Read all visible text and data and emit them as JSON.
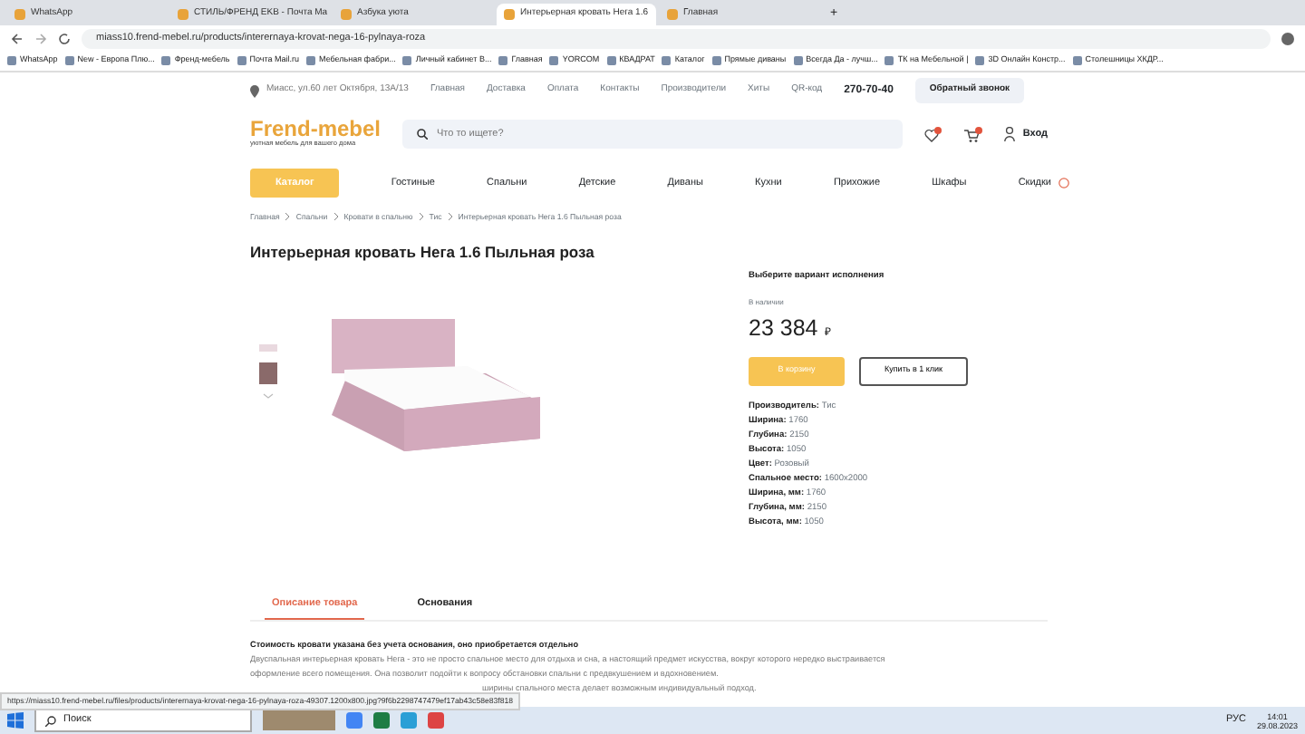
{
  "browser": {
    "tabs": [
      {
        "title": "WhatsApp",
        "selected": false
      },
      {
        "title": "СТИЛЬ/ФРЕНД EKB - Почта Ma",
        "selected": false
      },
      {
        "title": "Азбука уюта",
        "selected": false
      },
      {
        "title": "Интерьерная кровать Нега 1.6",
        "selected": true
      },
      {
        "title": "Главная",
        "selected": false
      }
    ],
    "new_tab": "+",
    "url": "miass10.frend-mebel.ru/products/interernaya-krovat-nega-16-pylnaya-roza",
    "bookmarks": [
      "WhatsApp",
      "New - Европа Плю...",
      "Френд-мебель",
      "Почта Mail.ru",
      "Мебельная фабри...",
      "Личный кабинет В...",
      "Главная",
      "YORCOM",
      "КВАДРАТ",
      "Каталог",
      "Прямые диваны",
      "Всегда Да - лучш...",
      "ТК на Мебельной |",
      "3D Онлайн Констр...",
      "Столешницы ХКДР..."
    ]
  },
  "site": {
    "address": "Миасс, ул.60 лет Октября, 13А/13",
    "top_links": [
      "Главная",
      "Доставка",
      "Оплата",
      "Контакты",
      "Производители",
      "Хиты",
      "QR-код"
    ],
    "phone": "270-70-40",
    "callback": "Обратный звонок",
    "logo": "Frend-mebel",
    "tagline": "уютная мебель для вашего дома",
    "search_placeholder": "Что то ищете?",
    "login": "Вход",
    "catalog": "Каталог",
    "nav": [
      "Гостиные",
      "Спальни",
      "Детские",
      "Диваны",
      "Кухни",
      "Прихожие",
      "Шкафы"
    ],
    "sale": "Скидки"
  },
  "breadcrumbs": [
    "Главная",
    "Спальни",
    "Кровати в спальню",
    "Тис",
    "Интерьерная кровать Нега 1.6 Пыльная роза"
  ],
  "title": "Интерьерная кровать Нега 1.6 Пыльная роза",
  "variant_heading": "Выберите вариант исполнения",
  "stock": "В наличии",
  "price": "23 384",
  "currency": "₽",
  "cart_button": "В корзину",
  "one_click_button": "Купить в 1 клик",
  "specs": [
    {
      "label": "Производитель:",
      "value": "Тис"
    },
    {
      "label": "Ширина:",
      "value": "1760"
    },
    {
      "label": "Глубина:",
      "value": "2150"
    },
    {
      "label": "Высота:",
      "value": "1050"
    },
    {
      "label": "Цвет:",
      "value": "Розовый"
    },
    {
      "label": "Спальное место:",
      "value": "1600x2000"
    },
    {
      "label": "Ширина, мм:",
      "value": "1760"
    },
    {
      "label": "Глубина, мм:",
      "value": "2150"
    },
    {
      "label": "Высота, мм:",
      "value": "1050"
    }
  ],
  "tabs": [
    {
      "label": "Описание товара",
      "selected": true
    },
    {
      "label": "Основания",
      "selected": false
    }
  ],
  "desc_title": "Стоимость кровати указана без учета основания, оно приобретается отдельно",
  "desc_text": "Двуспальная интерьерная кровать Нега - это не просто спальное место для отдыха и сна, а настоящий предмет искусства, вокруг которого нередко выстраивается оформление всего помещения. Она позволит подойти к вопросу обстановки спальни с предвкушением и вдохновением.",
  "desc_tail": "ширины спального места делает возможным индивидуальный подход.",
  "status_url": "https://miass10.frend-mebel.ru/files/products/interernaya-krovat-nega-16-pylnaya-roza-49307.1200x800.jpg?9f6b2298747479ef17ab43c58e83f818",
  "taskbar": {
    "search": "Поиск",
    "lang": "РУС",
    "time": "14:01",
    "date": "29.08.2023"
  }
}
